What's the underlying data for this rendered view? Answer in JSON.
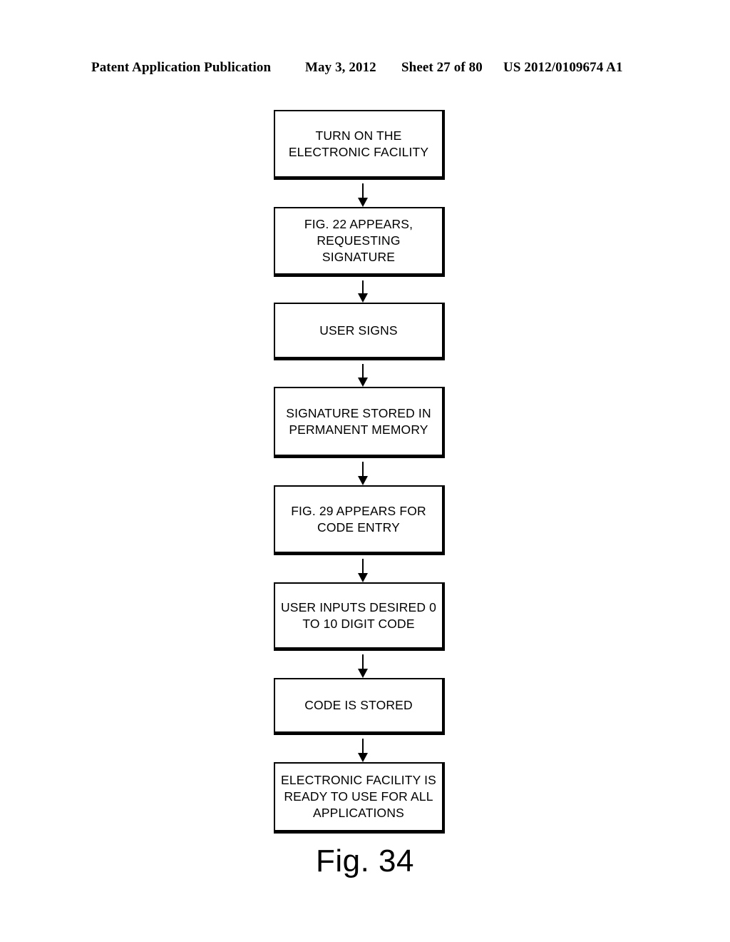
{
  "header": {
    "publication": "Patent Application Publication",
    "date": "May 3, 2012",
    "sheet": "Sheet 27 of 80",
    "document_number": "US 2012/0109674 A1"
  },
  "figure": {
    "caption": "Fig. 34",
    "nodes": [
      {
        "id": "turn-on",
        "label": "TURN ON THE\nELECTRONIC FACILITY"
      },
      {
        "id": "fig22-appears",
        "label": "FIG. 22 APPEARS,\nREQUESTING SIGNATURE"
      },
      {
        "id": "user-signs",
        "label": "USER SIGNS"
      },
      {
        "id": "signature-stored",
        "label": "SIGNATURE STORED IN\nPERMANENT MEMORY"
      },
      {
        "id": "fig29-appears",
        "label": "FIG. 29 APPEARS FOR\nCODE ENTRY"
      },
      {
        "id": "user-inputs-code",
        "label": "USER INPUTS DESIRED 0\nTO 10 DIGIT CODE"
      },
      {
        "id": "code-stored",
        "label": "CODE IS STORED"
      },
      {
        "id": "ready-to-use",
        "label": "ELECTRONIC FACILITY IS\nREADY TO USE FOR ALL\nAPPLICATIONS"
      }
    ],
    "connectors": [
      {
        "from": "turn-on",
        "to": "fig22-appears",
        "icon": "arrow-down-icon"
      },
      {
        "from": "fig22-appears",
        "to": "user-signs",
        "icon": "arrow-down-icon"
      },
      {
        "from": "user-signs",
        "to": "signature-stored",
        "icon": "arrow-down-icon"
      },
      {
        "from": "signature-stored",
        "to": "fig29-appears",
        "icon": "arrow-down-icon"
      },
      {
        "from": "fig29-appears",
        "to": "user-inputs-code",
        "icon": "arrow-down-icon"
      },
      {
        "from": "user-inputs-code",
        "to": "code-stored",
        "icon": "arrow-down-icon"
      },
      {
        "from": "code-stored",
        "to": "ready-to-use",
        "icon": "arrow-down-icon"
      }
    ]
  },
  "colors": {
    "ink": "#000000",
    "page": "#ffffff"
  }
}
